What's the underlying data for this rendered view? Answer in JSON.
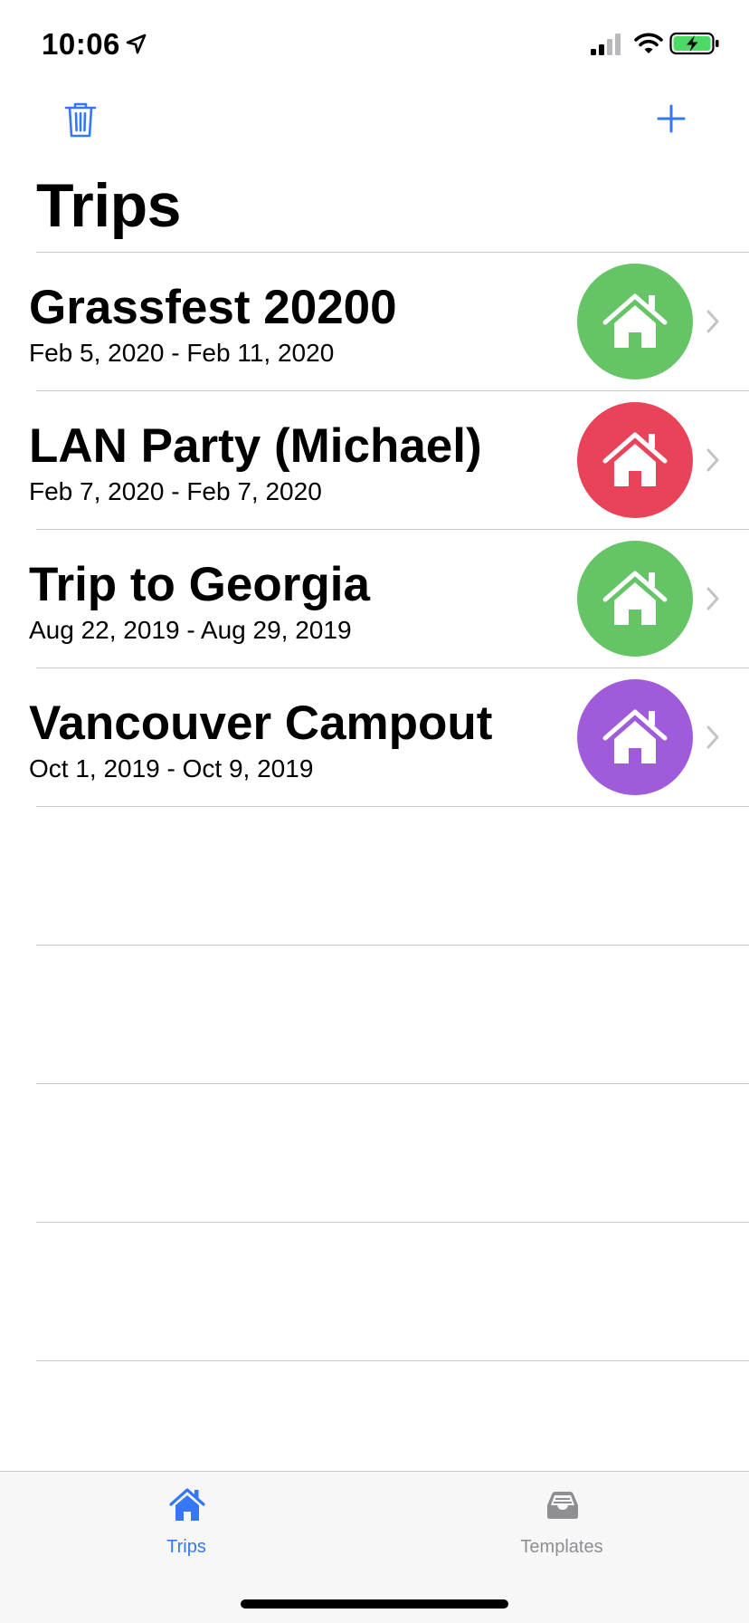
{
  "status_bar": {
    "time": "10:06"
  },
  "nav": {
    "title": "Trips"
  },
  "colors": {
    "accent": "#3478f6",
    "green": "#65c466",
    "red": "#e9435a",
    "purple": "#a05bdb",
    "chevron": "#c4c4c7",
    "inactive_tab": "#8e8e93"
  },
  "trips": [
    {
      "title": "Grassfest 20200",
      "dates": "Feb 5, 2020 - Feb 11, 2020",
      "icon": "house-icon",
      "color": "#65c466"
    },
    {
      "title": "LAN Party (Michael)",
      "dates": "Feb 7, 2020 - Feb 7, 2020",
      "icon": "house-icon",
      "color": "#e9435a"
    },
    {
      "title": "Trip to Georgia",
      "dates": "Aug 22, 2019 - Aug 29, 2019",
      "icon": "house-icon",
      "color": "#65c466"
    },
    {
      "title": "Vancouver Campout",
      "dates": "Oct 1, 2019 - Oct 9, 2019",
      "icon": "house-icon",
      "color": "#a05bdb"
    }
  ],
  "tabs": [
    {
      "label": "Trips",
      "icon": "house-icon",
      "selected": true
    },
    {
      "label": "Templates",
      "icon": "tray-icon",
      "selected": false
    }
  ]
}
